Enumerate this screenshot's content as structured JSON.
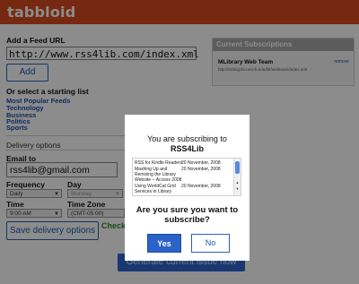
{
  "app": {
    "logo": "tabbloid"
  },
  "feed": {
    "heading": "Add a Feed URL",
    "url_value": "http://www.rss4lib.com/index.xml",
    "add_label": "Add"
  },
  "starting_list": {
    "heading": "Or select a starting list",
    "items": [
      "Most Popular Feeds",
      "Technology",
      "Business",
      "Politics",
      "Sports"
    ]
  },
  "delivery": {
    "heading": "Delivery options",
    "email_label": "Email to",
    "email_value": "rss4lib@gmail.com",
    "frequency_label": "Frequency",
    "frequency_value": "Daily",
    "day_label": "Day",
    "day_value": "Monday",
    "time_label": "Time",
    "time_value": "9:00 AM",
    "timezone_label": "Time Zone",
    "timezone_value": "(CMT-05:00) Eastern T",
    "save_label": "Save delivery options",
    "check_text": "Check y"
  },
  "generate_label": "Generate current issue now",
  "subscriptions": {
    "heading": "Current Subscriptions",
    "items": [
      {
        "name": "MLibrary Web Team",
        "url": "http://mblog.lib.umich.edu/blt/webteam/index.xml",
        "remove": "remove"
      }
    ]
  },
  "modal": {
    "title_line1": "You are subscribing to",
    "title_line2": "RSS4Lib",
    "entries": [
      {
        "title": "RSS for Kindle Readers",
        "date": "20 November, 2008"
      },
      {
        "title": "Mashing Up and",
        "date": "20 November, 2008"
      },
      {
        "title": "Remixing the Library",
        "date": ""
      },
      {
        "title": "Website -- Access 2008",
        "date": ""
      },
      {
        "title": "Using WorldCat Grid",
        "date": "20 November, 2008"
      },
      {
        "title": "Services in Library",
        "date": ""
      }
    ],
    "question_line1": "Are you sure you want to",
    "question_line2": "subscribe?",
    "yes_label": "Yes",
    "no_label": "No"
  }
}
